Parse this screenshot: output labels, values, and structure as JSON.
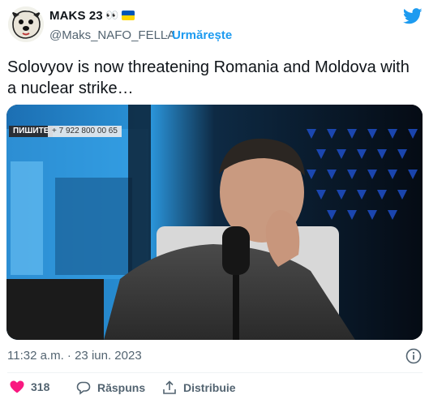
{
  "author": {
    "display_name": "MAKS 23",
    "emoji": "👀",
    "handle": "@Maks_NAFO_FELLA",
    "separator": "·",
    "follow_label": "Urmărește",
    "flag_colors": [
      "#0057b7",
      "#ffd700"
    ]
  },
  "tweet": {
    "text": "Solovyov is now threatening Romania and Moldova with a nuclear strike…",
    "timestamp": "11:32 a.m. · 23 iun. 2023"
  },
  "media": {
    "overlay_label": "ПИШИТЕ",
    "overlay_phone": "+ 7 922 800 00 65"
  },
  "actions": {
    "like_count": "318",
    "reply_label": "Răspuns",
    "share_label": "Distribuie"
  },
  "colors": {
    "accent": "#1d9bf0",
    "like": "#f91880",
    "muted": "#536471"
  },
  "icons": [
    "twitter-bird-icon",
    "info-icon",
    "heart-icon",
    "reply-icon",
    "share-icon"
  ]
}
